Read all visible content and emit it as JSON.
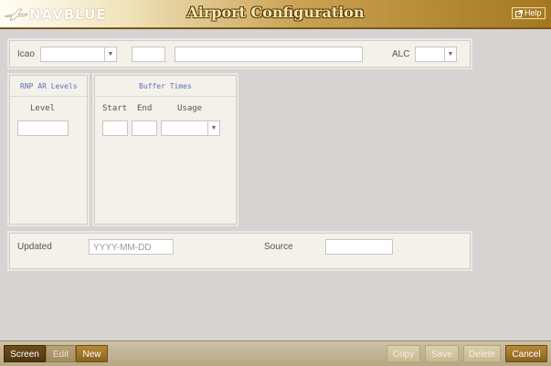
{
  "header": {
    "brand": "NAVBLUE",
    "title": "Airport Configuration",
    "help_label": "Help"
  },
  "top_panel": {
    "icao_label": "Icao",
    "alc_label": "ALC"
  },
  "rnp_panel": {
    "title": "RNP AR Levels",
    "level_label": "Level"
  },
  "buffer_panel": {
    "title": "Buffer Times",
    "start_label": "Start",
    "end_label": "End",
    "usage_label": "Usage"
  },
  "bottom_panel": {
    "updated_label": "Updated",
    "updated_placeholder": "YYYY-MM-DD",
    "source_label": "Source"
  },
  "footer": {
    "screen_label": "Screen",
    "edit_label": "Edit",
    "new_label": "New",
    "copy_label": "Copy",
    "save_label": "Save",
    "delete_label": "Delete",
    "cancel_label": "Cancel"
  },
  "icons": {
    "logo": "navblue-plane-logo",
    "help": "external-link-icon",
    "dropdown": "chevron-down-icon"
  }
}
